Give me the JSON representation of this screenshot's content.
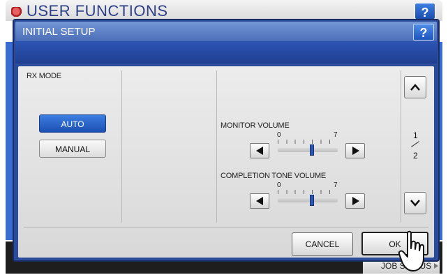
{
  "background_app": {
    "title": "USER FUNCTIONS",
    "help_label": "?",
    "job_status_label": "JOB STATUS"
  },
  "dialog": {
    "title": "INITIAL SETUP",
    "help_label": "?"
  },
  "rx_mode": {
    "label": "RX MODE",
    "options": [
      "AUTO",
      "MANUAL"
    ],
    "selected": "AUTO"
  },
  "monitor_volume": {
    "label": "MONITOR VOLUME",
    "min_label": "0",
    "max_label": "7",
    "value": 4,
    "min": 0,
    "max": 7
  },
  "completion_tone_volume": {
    "label": "COMPLETION TONE VOLUME",
    "min_label": "0",
    "max_label": "7",
    "value": 4,
    "min": 0,
    "max": 7
  },
  "pagination": {
    "current": "1",
    "total": "2"
  },
  "footer": {
    "cancel_label": "CANCEL",
    "ok_label": "OK"
  },
  "colors": {
    "dialog_frame": "#2b4c9a",
    "selected_button": "#2a63c8",
    "panel": "#e4e4e4"
  }
}
